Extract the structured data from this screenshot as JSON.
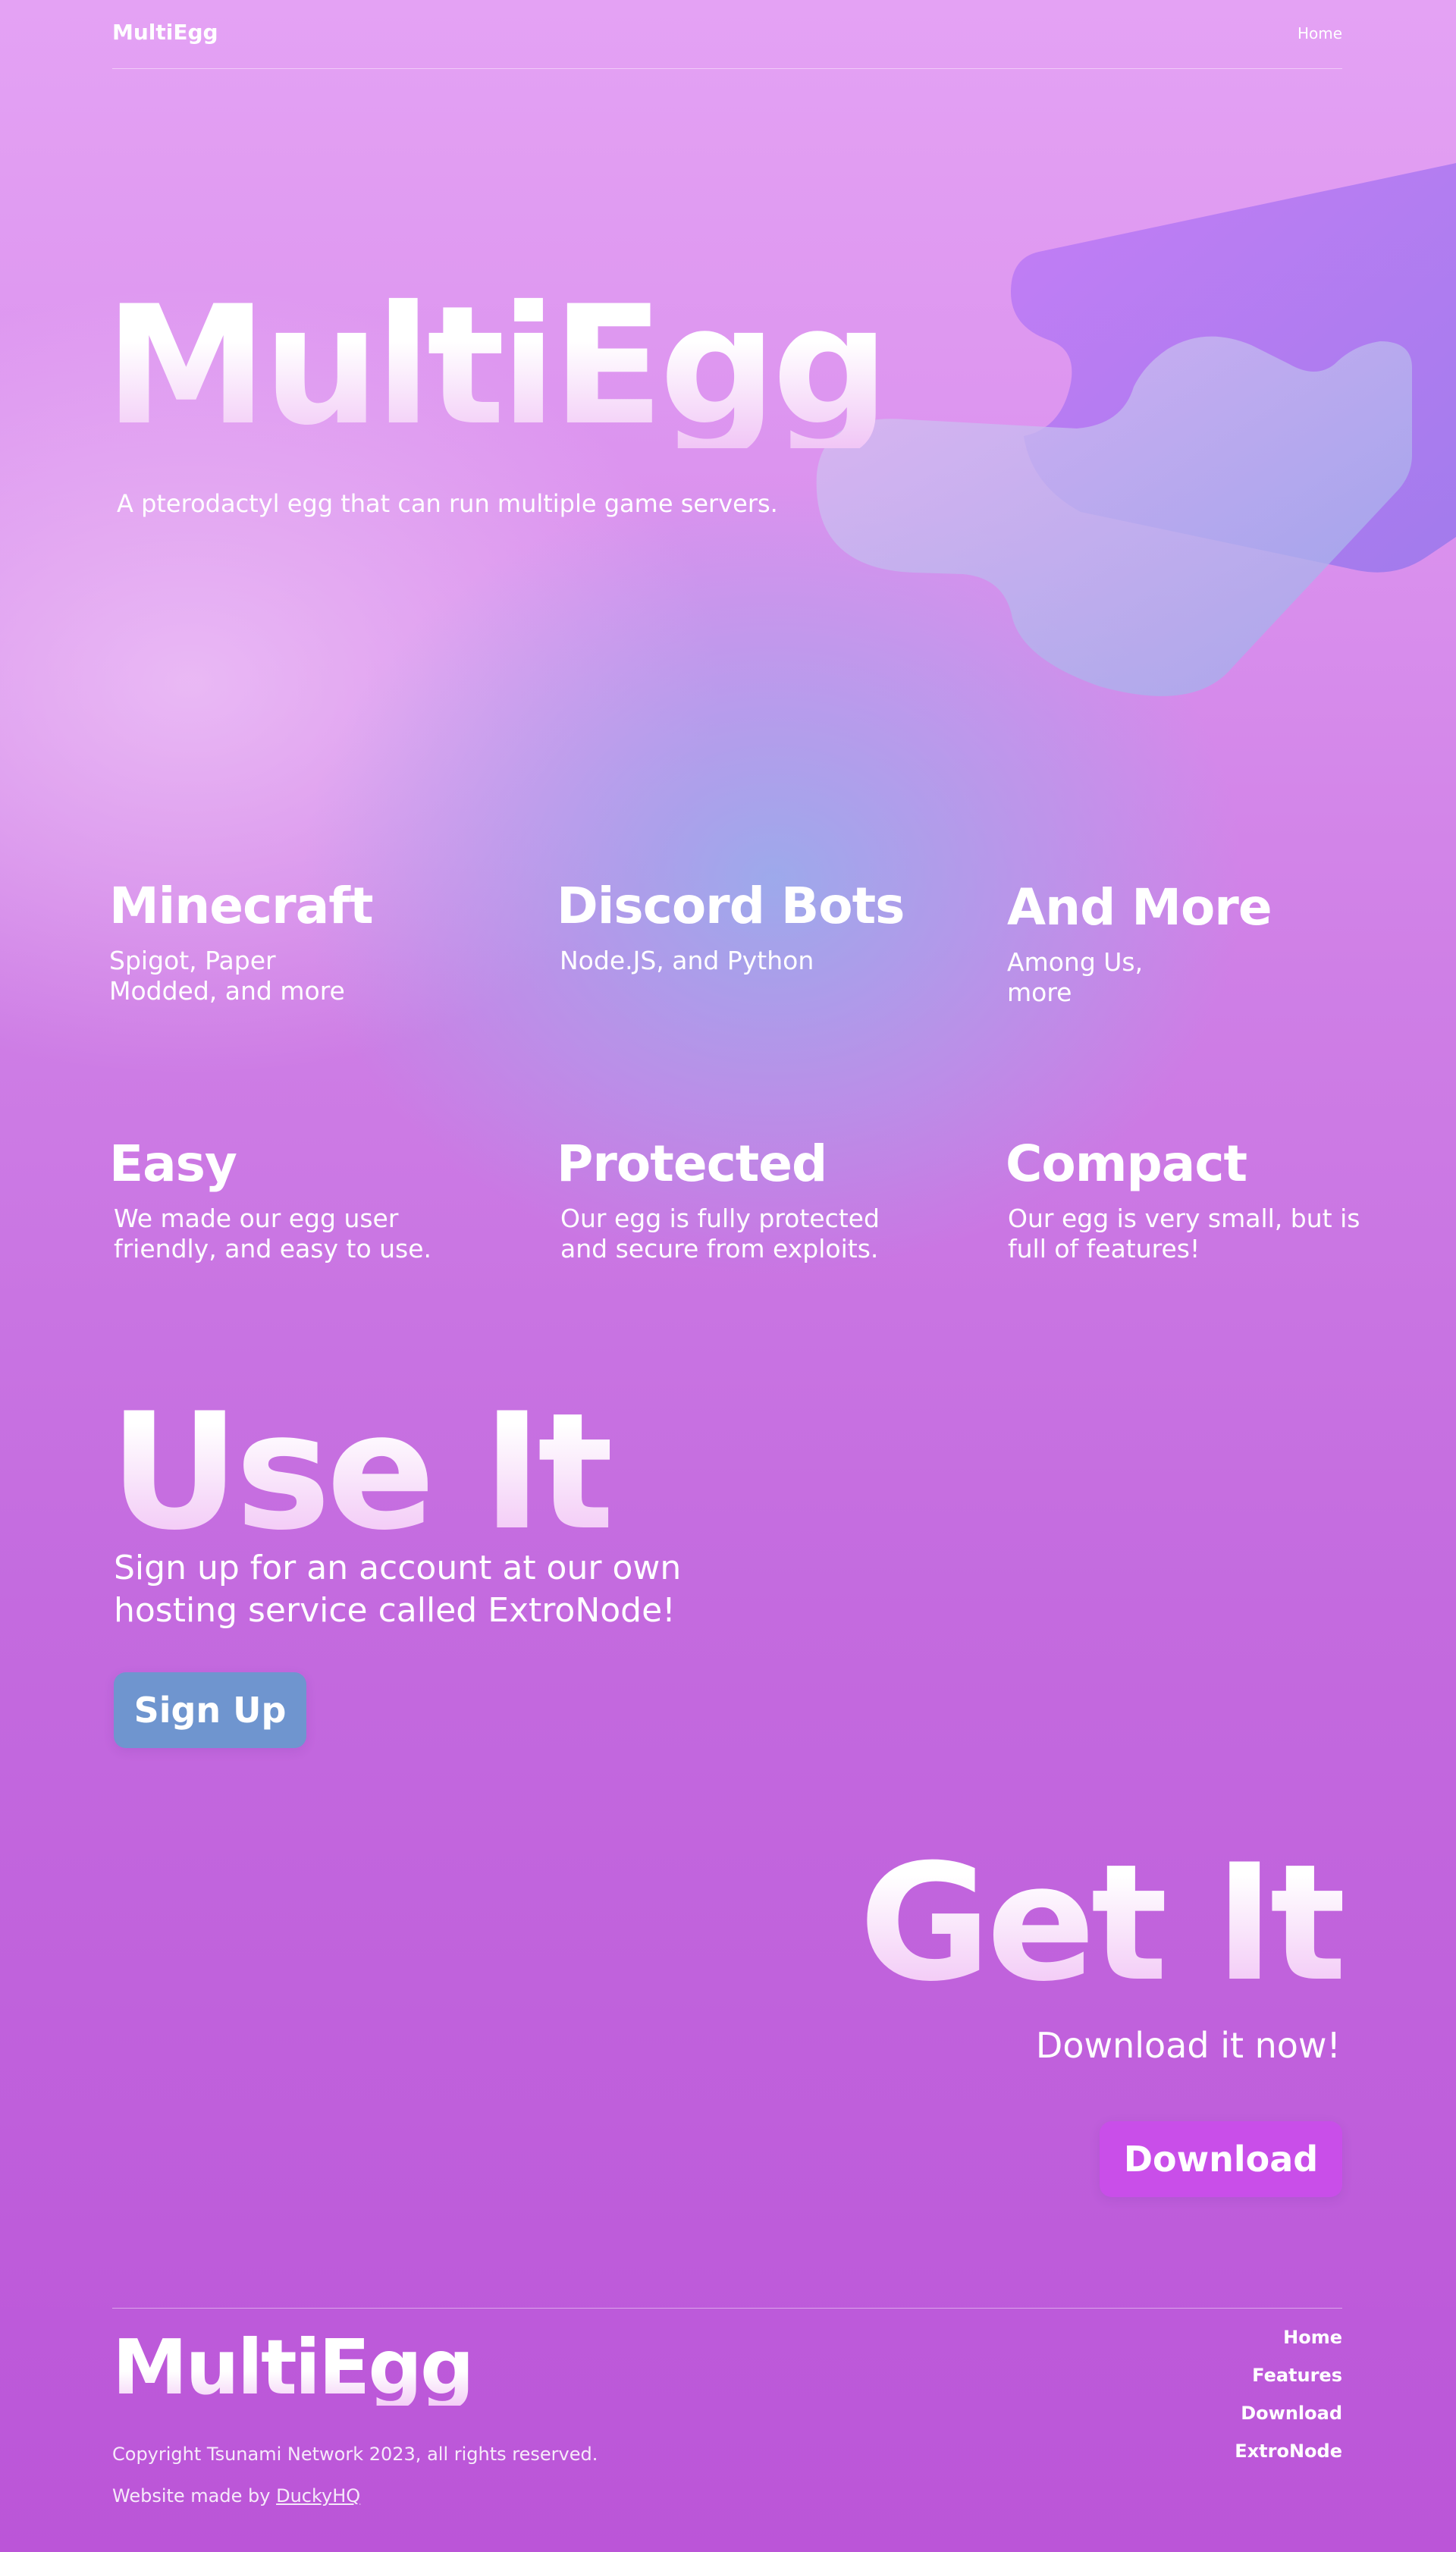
{
  "nav": {
    "brand": "MultiEgg",
    "home": "Home"
  },
  "hero": {
    "title": "MultiEgg",
    "subtitle": "A pterodactyl egg that can run multiple game servers."
  },
  "supports": [
    {
      "title": "Minecraft",
      "lines": [
        "Spigot, Paper",
        "Modded, and more"
      ]
    },
    {
      "title": "Discord Bots",
      "lines": [
        "Node.JS, and Python"
      ]
    },
    {
      "title": "And More",
      "lines": [
        "Among Us,",
        "more"
      ]
    }
  ],
  "features": [
    {
      "title": "Easy",
      "lines": [
        "We made our egg user",
        "friendly, and easy to use."
      ]
    },
    {
      "title": "Protected",
      "lines": [
        "Our egg is fully protected",
        "and secure from exploits."
      ]
    },
    {
      "title": "Compact",
      "lines": [
        "Our egg is very small, but is",
        "full of features!"
      ]
    }
  ],
  "use_it": {
    "title": "Use It",
    "lines": [
      "Sign up for an account at our own",
      "hosting service called ExtroNode!"
    ],
    "button": "Sign Up"
  },
  "get_it": {
    "title": "Get It",
    "subtitle": "Download it now!",
    "button": "Download"
  },
  "footer": {
    "brand": "MultiEgg",
    "copyright": "Copyright Tsunami Network 2023, all rights reserved.",
    "credit_prefix": "Website made by",
    "credit_link": "DuckyHQ",
    "links": [
      "Home",
      "Features",
      "Download",
      "ExtroNode"
    ]
  },
  "colors": {
    "signup_button": "#6f95cf",
    "download_button": "#c94ee9",
    "blob_purple": "#b46cf4",
    "blob_blue": "#9eaae8"
  }
}
